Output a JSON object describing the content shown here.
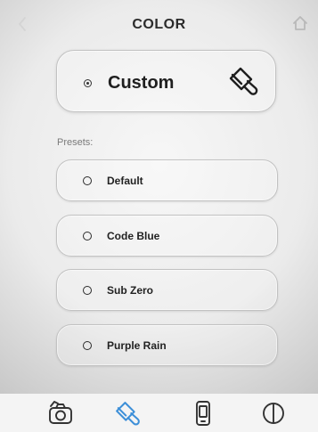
{
  "header": {
    "title": "COLOR",
    "back_icon": "chevron-left-icon",
    "home_icon": "home-icon"
  },
  "custom": {
    "label": "Custom",
    "selected": true,
    "icon": "paint-bucket-icon"
  },
  "presets": {
    "heading": "Presets:",
    "items": [
      {
        "label": "Default",
        "selected": false
      },
      {
        "label": "Code Blue",
        "selected": false
      },
      {
        "label": "Sub Zero",
        "selected": false
      },
      {
        "label": "Purple Rain",
        "selected": false
      }
    ]
  },
  "tabbar": {
    "items": [
      {
        "name": "camera",
        "icon": "camera-icon",
        "active": false
      },
      {
        "name": "color",
        "icon": "paint-bucket-icon",
        "active": true
      },
      {
        "name": "phone",
        "icon": "phone-icon",
        "active": false
      },
      {
        "name": "contrast",
        "icon": "contrast-icon",
        "active": false
      }
    ],
    "active_color": "#3d8fd8",
    "inactive_color": "#333333"
  }
}
